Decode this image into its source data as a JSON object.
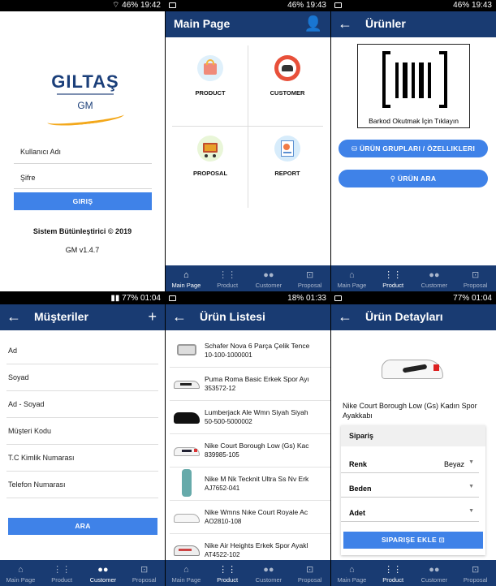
{
  "login": {
    "status_time": "19:42",
    "status_battery": "46%",
    "logo_text": "GILTAŞ",
    "logo_sub": "GM",
    "username_placeholder": "Kullanıcı Adı",
    "password_placeholder": "Şifre",
    "login_button": "GIRIŞ",
    "footer_line1": "Sistem Bütünleştirici © 2019",
    "footer_line2": "GM v1.4.7"
  },
  "main_page": {
    "status_time": "19:43",
    "status_battery": "46%",
    "title": "Main Page",
    "cells": [
      {
        "label": "PRODUCT",
        "icon": "shopping-bag-icon"
      },
      {
        "label": "CUSTOMER",
        "icon": "customer-group-icon"
      },
      {
        "label": "PROPOSAL",
        "icon": "shopping-cart-icon"
      },
      {
        "label": "REPORT",
        "icon": "report-icon"
      }
    ]
  },
  "urunler": {
    "status_time": "19:43",
    "status_battery": "46%",
    "title": "Ürünler",
    "barcode_caption": "Barkod Okutmak İçin Tıklayın",
    "groups_button": "ÜRÜN GRUPLARI / ÖZELLIKLERI",
    "search_button": "ÜRÜN ARA"
  },
  "musteriler": {
    "status_time": "01:04",
    "status_battery": "77%",
    "title": "Müşteriler",
    "add_symbol": "+",
    "fields": [
      "Ad",
      "Soyad",
      "Ad - Soyad",
      "Müşteri Kodu",
      "T.C Kimlik Numarası",
      "Telefon Numarası"
    ],
    "search_button": "ARA"
  },
  "urun_listesi": {
    "status_time": "01:33",
    "status_battery": "18%",
    "title": "Ürün Listesi",
    "items": [
      {
        "name": "Schafer Nova 6 Parça Çelik Tence",
        "code": "10-100-1000001"
      },
      {
        "name": "Puma Roma Basic Erkek Spor Ayı",
        "code": "353572-12"
      },
      {
        "name": "Lumberjack Ale Wmn Siyah Siyah",
        "code": "50-500-5000002"
      },
      {
        "name": "Nike Court Borough Low (Gs) Kac",
        "code": "839985-105"
      },
      {
        "name": "Nike M Nk Tecknit Ultra Ss Nv Erk",
        "code": "AJ7652-041"
      },
      {
        "name": "Nike Wmns Nıke Court Royale Ac",
        "code": "AO2810-108"
      },
      {
        "name": "Nike Air Heights Erkek Spor Ayakl",
        "code": "AT4522-102"
      }
    ]
  },
  "urun_detay": {
    "status_time": "01:04",
    "status_battery": "77%",
    "title": "Ürün Detayları",
    "product_name": "Nike Court Borough Low (Gs) Kadın Spor Ayakkabı",
    "order_header": "Sipariş",
    "color_label": "Renk",
    "color_value": "Beyaz",
    "size_label": "Beden",
    "qty_label": "Adet",
    "add_button": "SIPARIŞE EKLE"
  },
  "nav": {
    "main": "Main Page",
    "product": "Product",
    "customer": "Customer",
    "proposal": "Proposal"
  },
  "colors": {
    "appbar": "#193b72",
    "button": "#3f82e8",
    "logo_blue": "#1b3f7a",
    "logo_red": "#d8232a",
    "logo_orange": "#f3a81b"
  }
}
